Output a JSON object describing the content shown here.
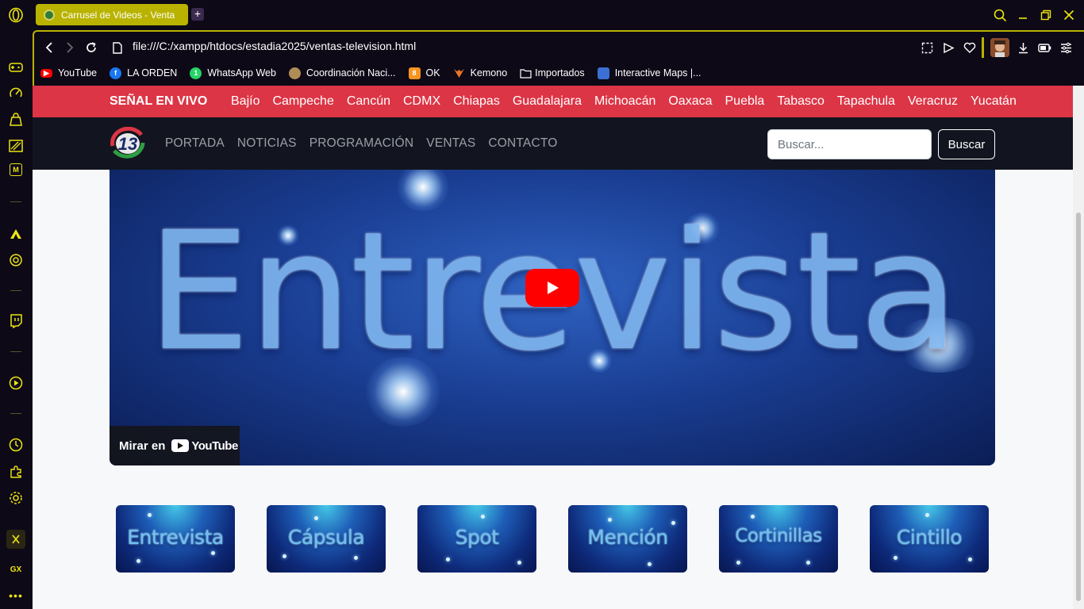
{
  "browser": {
    "tab_title": "Carrusel de Videos - Venta",
    "url": "file:///C:/xampp/htdocs/estadia2025/ventas-television.html",
    "new_tab_label": "+",
    "bookmarks": [
      {
        "label": "YouTube",
        "icon": "youtube-icon",
        "color": "#ff0000"
      },
      {
        "label": "LA ORDEN",
        "icon": "facebook-icon",
        "color": "#1877f2"
      },
      {
        "label": "WhatsApp Web",
        "icon": "whatsapp-icon",
        "color": "#25d366"
      },
      {
        "label": "Coordinación Naci...",
        "icon": "seal-icon",
        "color": "#b08d57"
      },
      {
        "label": "OK",
        "icon": "odnoklassniki-icon",
        "color": "#f7931e"
      },
      {
        "label": "Kemono",
        "icon": "fox-icon",
        "color": "#e8742a"
      },
      {
        "label": "Importados",
        "icon": "folder-icon",
        "color": "#ffffff"
      },
      {
        "label": "Interactive Maps |...",
        "icon": "map-icon",
        "color": "#3b6fd4"
      }
    ],
    "accent": "#ede60f",
    "gx_badge": "GX"
  },
  "page": {
    "live_label": "SEÑAL EN VIVO",
    "cities": [
      "Bajío",
      "Campeche",
      "Cancún",
      "CDMX",
      "Chiapas",
      "Guadalajara",
      "Michoacán",
      "Oaxaca",
      "Puebla",
      "Tabasco",
      "Tapachula",
      "Veracruz",
      "Yucatán"
    ],
    "logo_text": "13",
    "nav": [
      "PORTADA",
      "NOTICIAS",
      "PROGRAMACIÓN",
      "VENTAS",
      "CONTACTO"
    ],
    "search": {
      "placeholder": "Buscar...",
      "button": "Buscar"
    },
    "video": {
      "title": "Entrevista",
      "watch_on": "Mirar en",
      "yt_brand": "YouTube"
    },
    "thumbnails": [
      "Entrevista",
      "Cápsula",
      "Spot",
      "Mención",
      "Cortinillas",
      "Cintillo"
    ],
    "colors": {
      "live_bar": "#dc3545",
      "navbar": "#12151f",
      "play": "#ff0000"
    }
  }
}
